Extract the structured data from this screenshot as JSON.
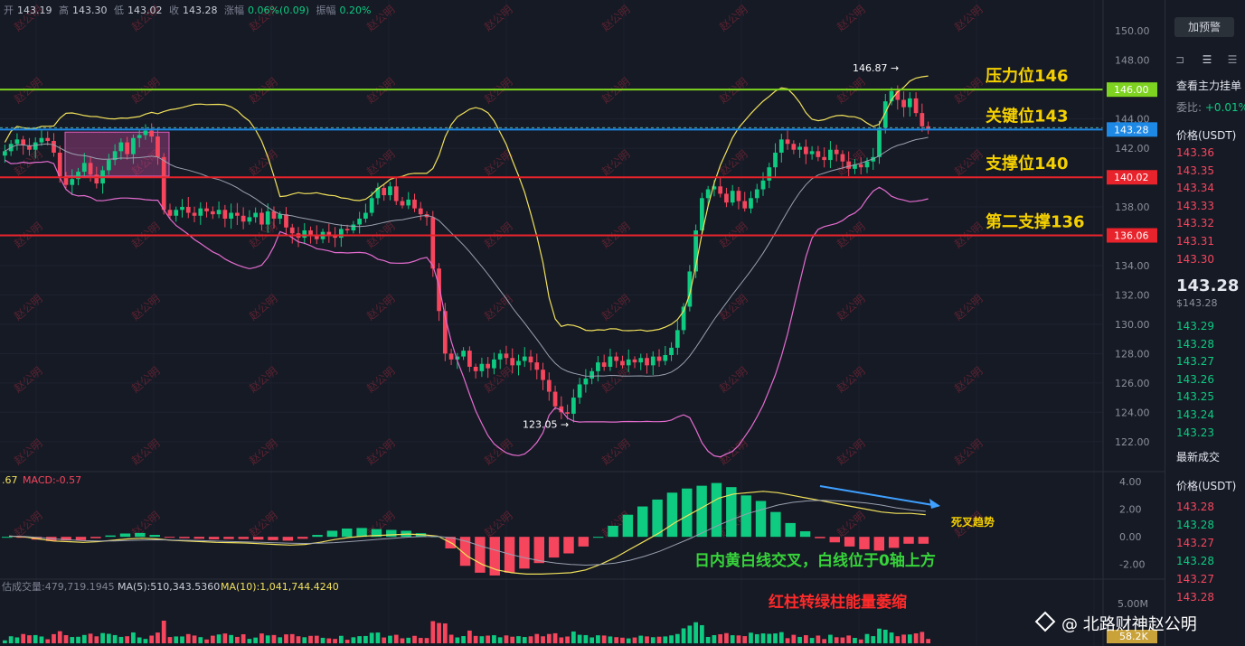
{
  "ohlc": {
    "open_label": "开",
    "open": "143.19",
    "high_label": "高",
    "high": "143.30",
    "low_label": "低",
    "low": "143.02",
    "close_label": "收",
    "close": "143.28",
    "change_label": "涨幅",
    "change": "0.06%(0.09)",
    "amp_label": "振幅",
    "amp": "0.20%"
  },
  "macd_label": {
    "prefix": ".67",
    "macd": "MACD:-0.57"
  },
  "volume_label": {
    "vol": "估成交量:479,719.1945",
    "ma5": "MA(5):510,343.5360",
    "ma10": "MA(10):1,041,744.4240"
  },
  "annotations": {
    "high_marker": "146.87 →",
    "low_marker": "123.05 →",
    "resistance": "压力位146",
    "key": "关键位143",
    "support": "支撑位140",
    "support2": "第二支撑136",
    "death_cross": "死叉趋势",
    "macd_note": "日内黄白线交叉，白线位于0轴上方",
    "hist_note": "红柱转绿柱能量萎缩",
    "watermark_text": "赵公明"
  },
  "price_tags": {
    "resistance": "146.00",
    "key": "143.28",
    "support": "140.02",
    "support2": "136.06"
  },
  "y_axis": {
    "price_ticks": [
      "150.00",
      "148.00",
      "144.00",
      "142.00",
      "138.00",
      "134.00",
      "132.00",
      "130.00",
      "128.00",
      "126.00",
      "124.00",
      "122.00"
    ],
    "macd_ticks": [
      "4.00",
      "2.00",
      "0.00",
      "-2.00"
    ],
    "vol_tick": "5.00M",
    "vol_tag": "58.2K"
  },
  "colors": {
    "up": "#0ecb81",
    "down": "#f6465d",
    "resistance": "#7ed321",
    "key": "#1e88e5",
    "support": "#e8232b",
    "annotation": "#f5d000"
  },
  "sidebar": {
    "alert_button": "加预警",
    "book_title": "查看主力挂单",
    "ratio": "委比:",
    "ratio_value": "+0.01%",
    "price_header": "价格(USDT)",
    "asks": [
      "143.36",
      "143.35",
      "143.34",
      "143.33",
      "143.32",
      "143.31",
      "143.30"
    ],
    "last_price": "143.28",
    "last_price_usd": "$143.28",
    "bids": [
      "143.29",
      "143.28",
      "143.27",
      "143.26",
      "143.25",
      "143.24",
      "143.23"
    ],
    "trades_title": "最新成交",
    "trades_header": "价格(USDT)",
    "trades": [
      {
        "price": "143.28",
        "side": "down"
      },
      {
        "price": "143.28",
        "side": "up"
      },
      {
        "price": "143.27",
        "side": "down"
      },
      {
        "price": "143.28",
        "side": "up"
      },
      {
        "price": "143.27",
        "side": "down"
      },
      {
        "price": "143.28",
        "side": "down"
      }
    ]
  },
  "footer_watermark": "@ 北路财神赵公明",
  "chart_data": {
    "type": "candlestick",
    "interval_note": "",
    "ylim": [
      121,
      151
    ],
    "levels": [
      {
        "name": "压力位146",
        "value": 146.0
      },
      {
        "name": "关键位143",
        "value": 143.28
      },
      {
        "name": "支撑位140",
        "value": 140.02
      },
      {
        "name": "第二支撑136",
        "value": 136.06
      }
    ],
    "high": 146.87,
    "low": 123.05,
    "close_path": [
      141.8,
      142.3,
      142.6,
      142.2,
      141.9,
      142.4,
      142.7,
      142.5,
      141.7,
      140.1,
      139.5,
      139.9,
      140.4,
      141.0,
      140.2,
      139.6,
      140.5,
      141.2,
      141.8,
      142.4,
      141.6,
      142.7,
      142.9,
      143.2,
      142.8,
      141.4,
      137.8,
      137.4,
      137.8,
      138.0,
      137.6,
      137.4,
      137.9,
      137.7,
      137.5,
      137.8,
      137.2,
      137.6,
      137.4,
      137.0,
      137.3,
      137.6,
      136.8,
      137.7,
      137.2,
      137.5,
      136.6,
      136.2,
      135.9,
      136.4,
      136.1,
      135.8,
      136.3,
      136.1,
      135.9,
      136.5,
      136.4,
      136.8,
      137.2,
      137.6,
      138.6,
      139.3,
      138.8,
      139.4,
      138.4,
      138.1,
      138.5,
      137.9,
      137.5,
      137.3,
      133.8,
      130.9,
      128.0,
      127.6,
      127.8,
      128.2,
      127.1,
      126.8,
      127.3,
      127.0,
      127.6,
      128.0,
      127.7,
      127.2,
      127.5,
      127.8,
      127.4,
      126.9,
      126.2,
      125.4,
      124.4,
      124.0,
      123.9,
      125.0,
      125.9,
      126.3,
      126.8,
      127.4,
      127.1,
      127.8,
      127.5,
      127.2,
      127.6,
      127.4,
      127.7,
      127.2,
      127.8,
      127.5,
      127.9,
      128.4,
      129.6,
      131.2,
      133.6,
      136.4,
      138.6,
      139.2,
      139.4,
      138.9,
      138.3,
      139.1,
      138.4,
      137.9,
      138.6,
      139.2,
      139.8,
      140.7,
      141.7,
      142.6,
      142.3,
      141.9,
      142.1,
      141.6,
      141.8,
      141.4,
      141.2,
      141.9,
      141.6,
      141.1,
      140.6,
      140.9,
      140.7,
      141.1,
      141.4,
      143.4,
      145.2,
      145.9,
      145.3,
      144.8,
      145.4,
      144.4,
      143.5,
      143.28
    ],
    "macd": {
      "dif": [
        0.05,
        0.0,
        -0.15,
        -0.3,
        -0.35,
        -0.4,
        -0.35,
        -0.25,
        -0.15,
        -0.1,
        -0.15,
        -0.25,
        -0.3,
        -0.35,
        -0.4,
        -0.42,
        -0.45,
        -0.5,
        -0.55,
        -0.6,
        -0.55,
        -0.4,
        -0.2,
        -0.05,
        0.05,
        0.1,
        0.15,
        0.2,
        0.15,
        0.05,
        -0.5,
        -1.4,
        -2.0,
        -2.4,
        -2.6,
        -2.7,
        -2.7,
        -2.65,
        -2.6,
        -2.4,
        -2.0,
        -1.5,
        -0.9,
        -0.3,
        0.3,
        1.0,
        1.6,
        2.2,
        2.8,
        3.1,
        3.2,
        3.3,
        3.2,
        3.0,
        2.8,
        2.6,
        2.4,
        2.2,
        2.0,
        1.8,
        1.7,
        1.7,
        1.6
      ],
      "dea": [
        0.05,
        0.03,
        -0.05,
        -0.15,
        -0.22,
        -0.28,
        -0.3,
        -0.3,
        -0.27,
        -0.24,
        -0.22,
        -0.23,
        -0.25,
        -0.28,
        -0.31,
        -0.34,
        -0.37,
        -0.4,
        -0.43,
        -0.46,
        -0.48,
        -0.47,
        -0.42,
        -0.35,
        -0.27,
        -0.18,
        -0.1,
        -0.02,
        0.02,
        0.03,
        -0.08,
        -0.35,
        -0.7,
        -1.0,
        -1.3,
        -1.55,
        -1.75,
        -1.9,
        -2.0,
        -2.05,
        -2.0,
        -1.9,
        -1.7,
        -1.4,
        -1.05,
        -0.6,
        -0.15,
        0.35,
        0.85,
        1.3,
        1.7,
        2.0,
        2.3,
        2.5,
        2.6,
        2.65,
        2.6,
        2.55,
        2.45,
        2.3,
        2.1,
        1.95,
        1.85
      ]
    },
    "volume_note": ""
  }
}
